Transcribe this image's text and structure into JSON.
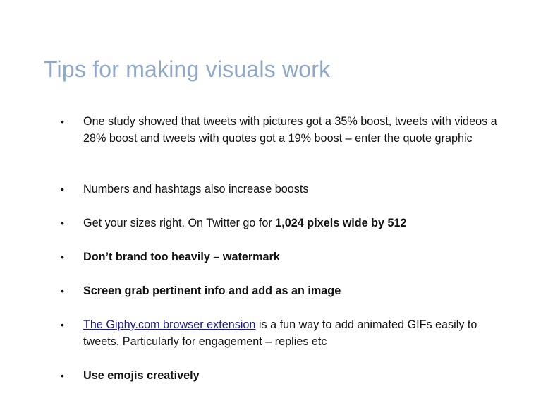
{
  "slide": {
    "title": "Tips for making visuals work",
    "bullet_glyph": "•",
    "bullets": [
      {
        "text": "One study showed that tweets with pictures got a 35% boost, tweets with videos a 28% boost and tweets with quotes got a 19% boost – enter the quote graphic"
      },
      {
        "text": "Numbers and hashtags also increase boosts"
      },
      {
        "text_plain": "Get your sizes right.  On Twitter go for ",
        "text_bold": "1,024 pixels wide by 512"
      },
      {
        "text": "Don’t brand too heavily – watermark",
        "bold": true
      },
      {
        "text": "Screen grab pertinent info and add as an image",
        "bold": true
      },
      {
        "link_text": "The Giphy.com browser extension",
        "text_after": " is a fun way to add animated GIFs easily to tweets. Particularly for engagement – replies etc"
      },
      {
        "text": "Use emojis creatively",
        "bold": true
      }
    ]
  },
  "colors": {
    "title": "#8fa7c8",
    "body_text": "#111111",
    "link": "#1a1a8c",
    "background": "#ffffff"
  }
}
